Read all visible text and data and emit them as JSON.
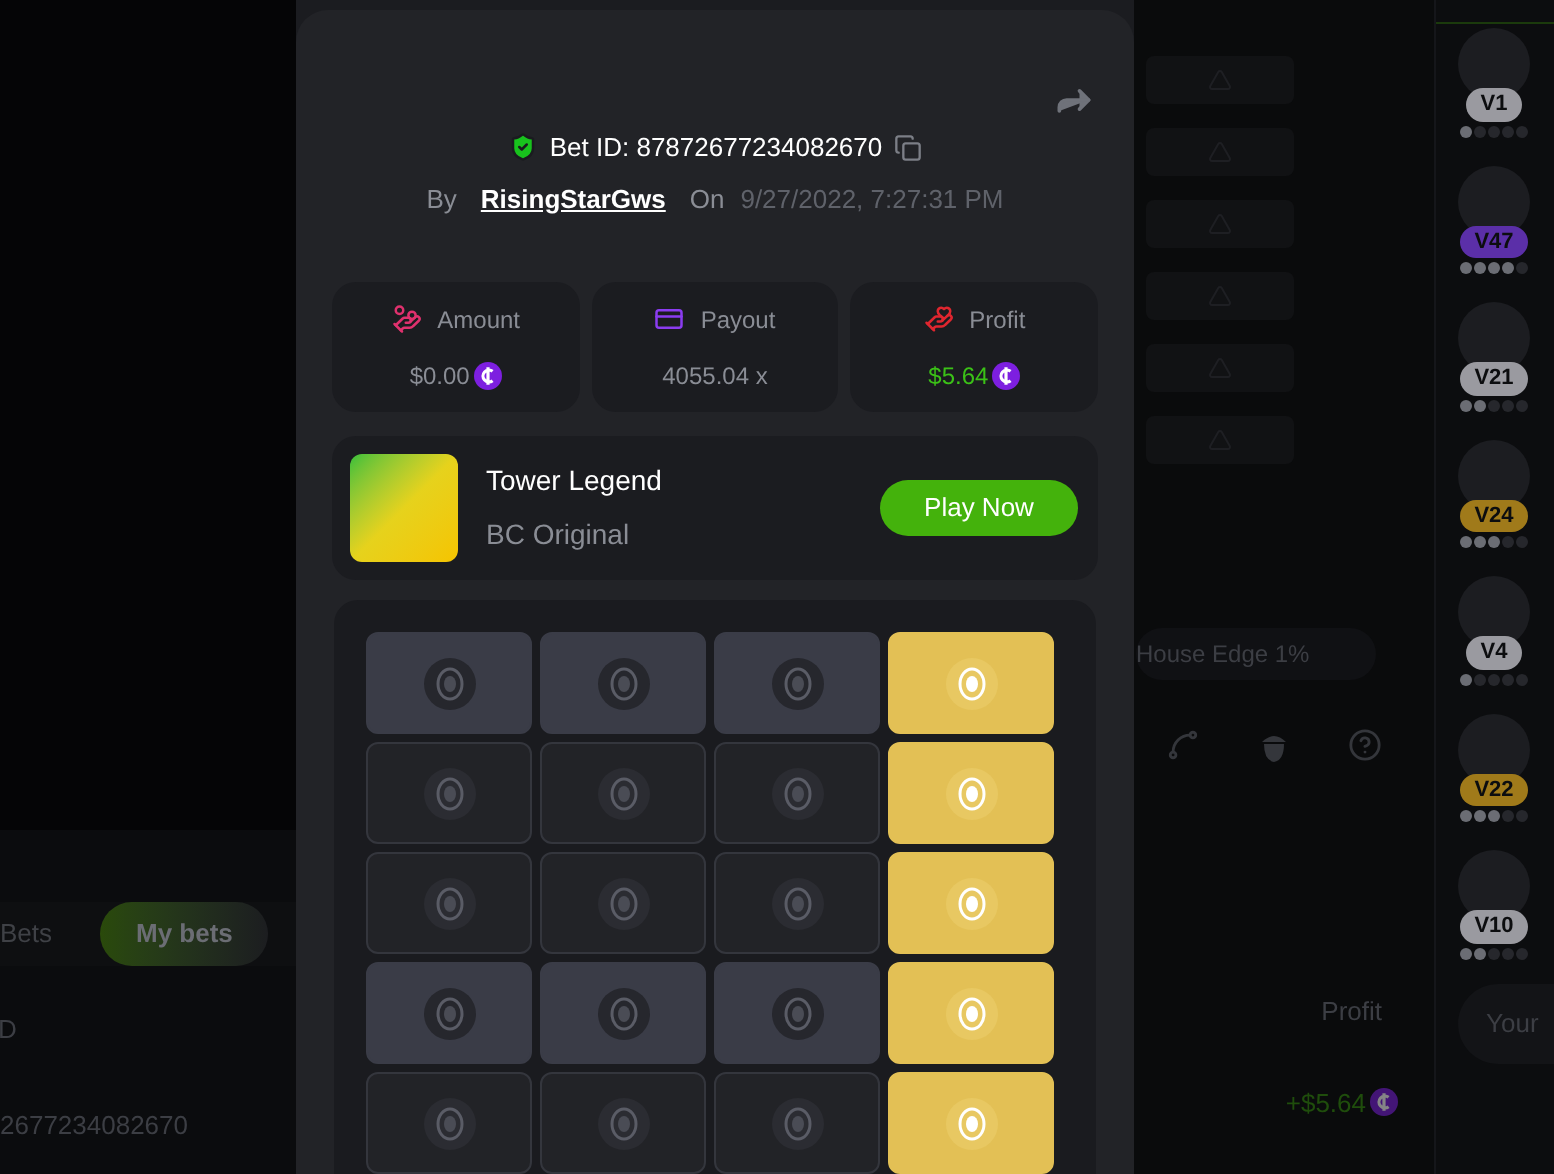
{
  "bet": {
    "id_label": "Bet ID: 87872677234082670",
    "by_label": "By",
    "user": "RisingStarGws",
    "on_label": "On",
    "date": "9/27/2022, 7:27:31 PM"
  },
  "stats": [
    {
      "kind": "amount",
      "label": "Amount",
      "value": "$0.00",
      "positive": false,
      "coin": true
    },
    {
      "kind": "payout",
      "label": "Payout",
      "value": "4055.04 x",
      "positive": false,
      "coin": false
    },
    {
      "kind": "profit",
      "label": "Profit",
      "value": "$5.64",
      "positive": true,
      "coin": true
    }
  ],
  "game": {
    "title": "Tower Legend",
    "subtitle": "BC Original",
    "button": "Play Now"
  },
  "grid": {
    "rows": [
      {
        "highlighted": true,
        "cells": [
          {
            "selected": false
          },
          {
            "selected": false
          },
          {
            "selected": false
          },
          {
            "selected": true
          }
        ]
      },
      {
        "highlighted": false,
        "cells": [
          {
            "selected": false
          },
          {
            "selected": false
          },
          {
            "selected": false
          },
          {
            "selected": true
          }
        ]
      },
      {
        "highlighted": false,
        "cells": [
          {
            "selected": false
          },
          {
            "selected": false
          },
          {
            "selected": false
          },
          {
            "selected": true
          }
        ]
      },
      {
        "highlighted": true,
        "cells": [
          {
            "selected": false
          },
          {
            "selected": false
          },
          {
            "selected": false
          },
          {
            "selected": true
          }
        ]
      },
      {
        "highlighted": false,
        "cells": [
          {
            "selected": false
          },
          {
            "selected": false
          },
          {
            "selected": false
          },
          {
            "selected": true
          }
        ]
      }
    ]
  },
  "background": {
    "tabs": [
      {
        "label": "Bets",
        "selected": false
      },
      {
        "label": "My bets",
        "selected": true
      }
    ],
    "columns": [
      "D",
      "Profit"
    ],
    "rows": [
      {
        "id": "2677234082670",
        "profit": "+$5.64"
      }
    ],
    "house_edge": "House Edge 1%",
    "players": [
      {
        "badge": "V1",
        "color": "#9a9aa0",
        "stars": 1
      },
      {
        "badge": "V47",
        "color": "#5b2fa8",
        "stars": 4
      },
      {
        "badge": "V21",
        "color": "#9a9aa0",
        "stars": 2
      },
      {
        "badge": "V24",
        "color": "#a07a1a",
        "stars": 3
      },
      {
        "badge": "V4",
        "color": "#9a9aa0",
        "stars": 1
      },
      {
        "badge": "V22",
        "color": "#a07a1a",
        "stars": 3
      },
      {
        "badge": "V10",
        "color": "#9a9aa0",
        "stars": 2
      }
    ],
    "chat_placeholder": "Your"
  }
}
